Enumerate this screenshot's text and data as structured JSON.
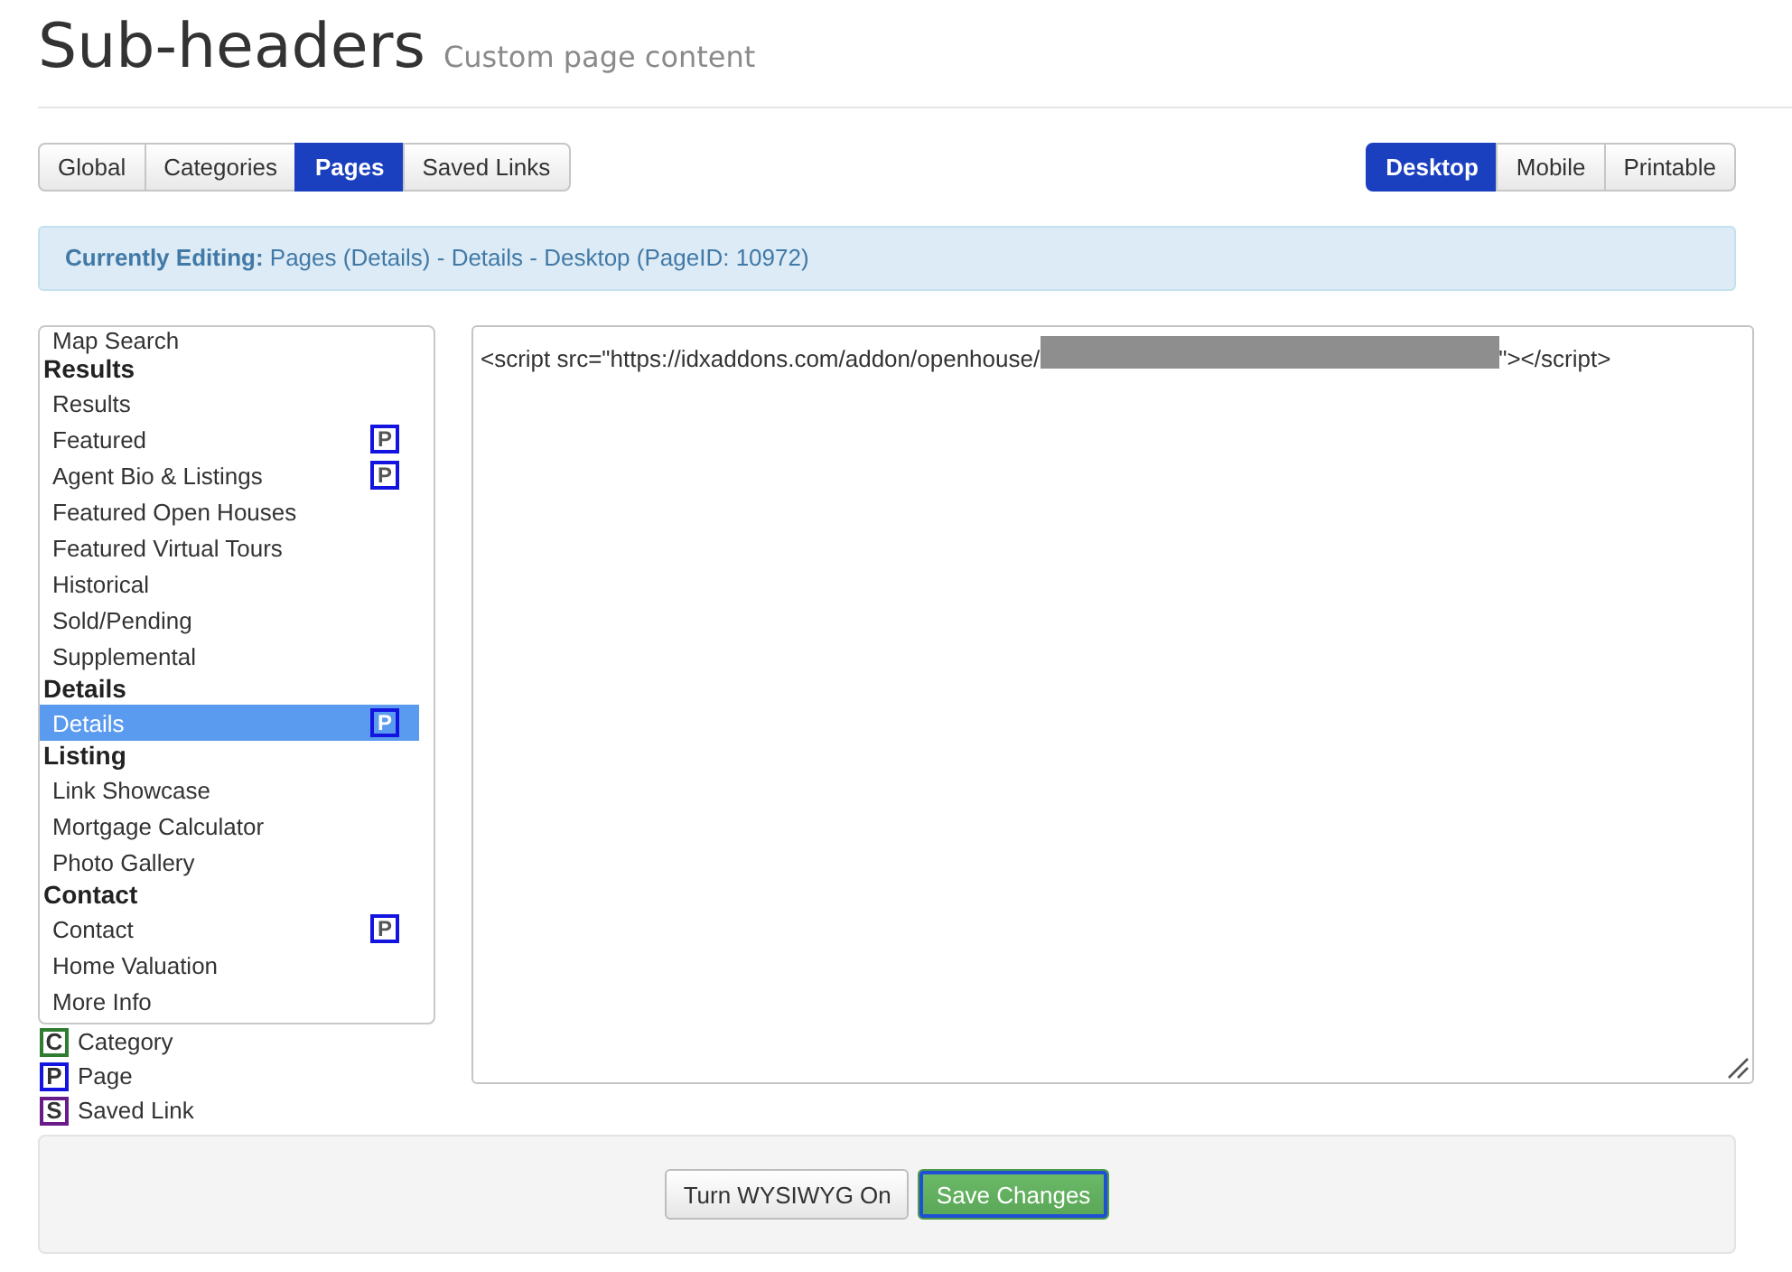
{
  "header": {
    "title": "Sub-headers",
    "subtitle": "Custom page content"
  },
  "view_tabs": [
    {
      "label": "Global",
      "selected": false
    },
    {
      "label": "Categories",
      "selected": false
    },
    {
      "label": "Pages",
      "selected": true
    },
    {
      "label": "Saved Links",
      "selected": false
    }
  ],
  "device_tabs": [
    {
      "label": "Desktop",
      "selected": true
    },
    {
      "label": "Mobile",
      "selected": false
    },
    {
      "label": "Printable",
      "selected": false
    }
  ],
  "alert": {
    "text": "**Currently Editing:** Pages (Details) - Details - Desktop (PageID: 10972)"
  },
  "page_list": {
    "groups": [
      {
        "items": [
          {
            "label": "Map Search",
            "selected": false
          }
        ]
      },
      {
        "heading": "Results",
        "items": [
          {
            "label": "Results",
            "selected": false
          },
          {
            "label": "Featured",
            "selected": false,
            "badge": {
              "letter": "P",
              "color": "#1414e0"
            }
          },
          {
            "label": "Agent Bio & Listings",
            "selected": false,
            "badge": {
              "letter": "P",
              "color": "#1414e0"
            }
          },
          {
            "label": "Featured Open Houses",
            "selected": false
          },
          {
            "label": "Featured Virtual Tours",
            "selected": false
          },
          {
            "label": "Historical",
            "selected": false
          },
          {
            "label": "Sold/Pending",
            "selected": false
          },
          {
            "label": "Supplemental",
            "selected": false
          }
        ]
      },
      {
        "heading": "Details",
        "items": [
          {
            "label": "Details",
            "selected": true,
            "badge": {
              "letter": "P",
              "color": "#1414e0"
            }
          }
        ]
      },
      {
        "heading": "Listing",
        "items": [
          {
            "label": "Link Showcase",
            "selected": false
          },
          {
            "label": "Mortgage Calculator",
            "selected": false
          },
          {
            "label": "Photo Gallery",
            "selected": false
          }
        ]
      },
      {
        "heading": "Contact",
        "items": [
          {
            "label": "Contact",
            "selected": false,
            "badge": {
              "letter": "P",
              "color": "#1414e0"
            }
          },
          {
            "label": "Home Valuation",
            "selected": false
          },
          {
            "label": "More Info",
            "selected": false
          }
        ]
      }
    ]
  },
  "legend": [
    {
      "letter": "C",
      "label": "Category",
      "color": "#2e7d32"
    },
    {
      "letter": "P",
      "label": "Page",
      "color": "#1414e0"
    },
    {
      "letter": "S",
      "label": "Saved Link",
      "color": "#6a1b8a"
    }
  ],
  "editor": {
    "code_before": "<script src=\"https://idxaddons.com/addon/openhouse/",
    "redacted": true,
    "code_after": "\"></script>"
  },
  "footer": {
    "buttons": [
      {
        "label": "Turn WYSIWYG On",
        "kind": "default",
        "focused": false
      },
      {
        "label": "Save Changes",
        "kind": "primary",
        "focused": true
      }
    ]
  }
}
